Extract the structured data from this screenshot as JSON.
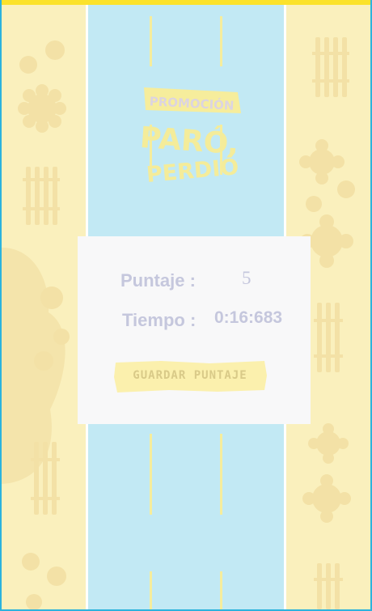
{
  "logo": {
    "line1": "PROMOCIÓN",
    "line2": "PARÓ,",
    "line3": "PERDIÓ"
  },
  "result": {
    "score_label": "Puntaje :",
    "score_value": "5",
    "time_label": "Tiempo :",
    "time_value": "0:16:683"
  },
  "actions": {
    "save_label": "GUARDAR PUNTAJE"
  },
  "colors": {
    "top_bar": "#fbe22b",
    "frame_border": "#2bb3dd",
    "road": "#c2e9f4",
    "sidewalk": "#faf0bd",
    "lane_marking": "#f6ed9c",
    "card": "#f8f8f9",
    "result_text": "#c5c7dd",
    "button": "#fbf0ad"
  }
}
